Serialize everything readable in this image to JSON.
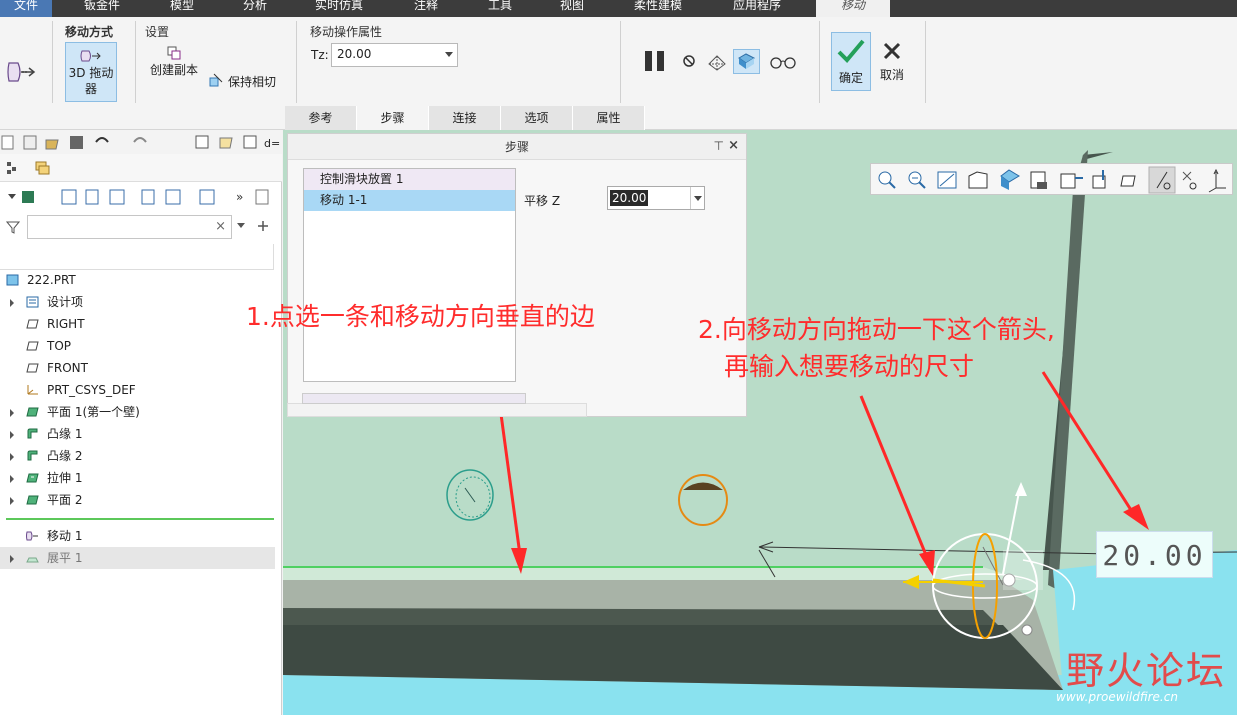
{
  "menubar": {
    "items": [
      "文件",
      "钣金件",
      "模型",
      "分析",
      "实时仿真",
      "注释",
      "工具",
      "视图",
      "柔性建模",
      "应用程序",
      "移动"
    ]
  },
  "ribbon": {
    "move_mode_title": "移动方式",
    "settings_title": "设置",
    "btn_3d_drag_line1": "3D 拖动",
    "btn_3d_drag_line2": "器",
    "create_copy": "创建副本",
    "keep_tangent": "保持相切",
    "move_props_title": "移动操作属性",
    "tz_label": "Tz:",
    "tz_value": "20.00",
    "tabs": [
      "参考",
      "步骤",
      "连接",
      "选项",
      "属性"
    ],
    "ok": "确定",
    "cancel": "取消"
  },
  "tree": {
    "root": "222.PRT",
    "items": [
      "设计项",
      "RIGHT",
      "TOP",
      "FRONT",
      "PRT_CSYS_DEF",
      "平面 1(第一个壁)",
      "凸缘 1",
      "凸缘 2",
      "拉伸 1",
      "平面 2",
      "移动 1",
      "展平 1"
    ]
  },
  "dialog": {
    "title": "步骤",
    "rows": [
      "控制滑块放置 1",
      "移动 1-1"
    ],
    "field_label": "平移 Z",
    "field_value": "20.00"
  },
  "annotations": {
    "note1": "1.点选一条和移动方向垂直的边",
    "note2_line1": "2.向移动方向拖动一下这个箭头,",
    "note2_line2": "再输入想要移动的尺寸"
  },
  "dimension": "20.00",
  "watermark": {
    "text": "野火论坛",
    "url": "www.proewildfire.cn"
  }
}
